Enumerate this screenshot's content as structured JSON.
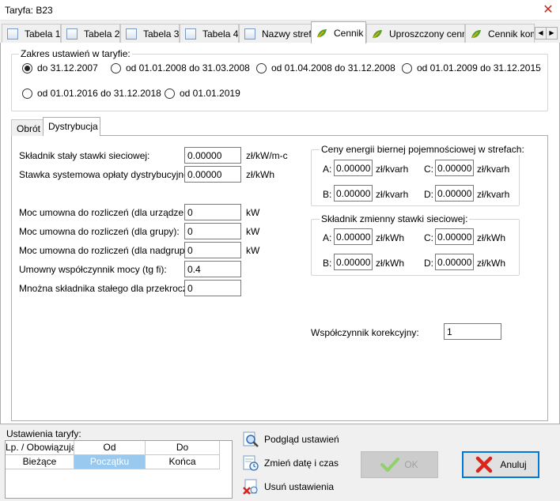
{
  "window": {
    "title": "Taryfa: B23"
  },
  "tabs": [
    {
      "label": "Tabela 1",
      "icon": "document-icon"
    },
    {
      "label": "Tabela 2",
      "icon": "document-icon"
    },
    {
      "label": "Tabela 3",
      "icon": "document-icon"
    },
    {
      "label": "Tabela 4",
      "icon": "document-icon"
    },
    {
      "label": "Nazwy stref",
      "icon": "document-icon"
    },
    {
      "label": "Cennik",
      "icon": "leaf-icon"
    },
    {
      "label": "Uproszczony cennik",
      "icon": "leaf-icon"
    },
    {
      "label": "Cennik komu",
      "icon": "leaf-icon"
    }
  ],
  "range": {
    "title": "Zakres ustawień w taryfie:",
    "options": [
      "do 31.12.2007",
      "od 01.01.2008 do 31.03.2008",
      "od 01.04.2008 do 31.12.2008",
      "od 01.01.2009 do 31.12.2015",
      "od 01.01.2016 do 31.12.2018",
      "od 01.01.2019"
    ],
    "selected": 0
  },
  "inner_tabs": [
    "Obrót",
    "Dystrybucja"
  ],
  "fields": {
    "skladnik_staly": {
      "label": "Składnik stały stawki sieciowej:",
      "value": "0.00000",
      "unit": "zł/kW/m-c"
    },
    "stawka_systemowa": {
      "label": "Stawka systemowa opłaty dystrybucyjnej:",
      "value": "0.00000",
      "unit": "zł/kWh"
    },
    "moc_urzadzenia": {
      "label": "Moc umowna do rozliczeń (dla urządzenia):",
      "value": "0",
      "unit": "kW"
    },
    "moc_grupy": {
      "label": "Moc umowna do rozliczeń (dla grupy):",
      "value": "0",
      "unit": "kW"
    },
    "moc_nadgrupy": {
      "label": "Moc umowna do rozliczeń (dla nadgrupy):",
      "value": "0",
      "unit": "kW"
    },
    "wspolczynnik_mocy": {
      "label": "Umowny współczynnik mocy (tg fi):",
      "value": "0.4"
    },
    "mnozna": {
      "label": "Mnożna składnika stałego dla przekroczeń:",
      "value": "0"
    }
  },
  "energia_biernej": {
    "title": "Ceny energii biernej pojemnościowej w strefach:",
    "cells": [
      {
        "label": "A:",
        "value": "0.00000",
        "unit": "zł/kvarh"
      },
      {
        "label": "C:",
        "value": "0.00000",
        "unit": "zł/kvarh"
      },
      {
        "label": "B:",
        "value": "0.00000",
        "unit": "zł/kvarh"
      },
      {
        "label": "D:",
        "value": "0.00000",
        "unit": "zł/kvarh"
      }
    ]
  },
  "skladnik_zmienny": {
    "title": "Składnik zmienny stawki sieciowej:",
    "cells": [
      {
        "label": "A:",
        "value": "0.00000",
        "unit": "zł/kWh"
      },
      {
        "label": "C:",
        "value": "0.00000",
        "unit": "zł/kWh"
      },
      {
        "label": "B:",
        "value": "0.00000",
        "unit": "zł/kWh"
      },
      {
        "label": "D:",
        "value": "0.00000",
        "unit": "zł/kWh"
      }
    ]
  },
  "korekcyjny": {
    "label": "Współczynnik korekcyjny:",
    "value": "1"
  },
  "settings": {
    "title": "Ustawienia taryfy:",
    "headers": [
      "Lp. / Obowiązują",
      "Od",
      "Do"
    ],
    "row": [
      "Bieżące",
      "Początku",
      "Końca"
    ]
  },
  "actions": {
    "preview": "Podgląd ustawień",
    "change_date": "Zmień datę i czas",
    "delete": "Usuń ustawienia"
  },
  "buttons": {
    "ok": "OK",
    "cancel": "Anuluj"
  },
  "colors": {
    "accent": "#0078d7",
    "selected_cell": "#99c9ef",
    "close": "#c42b1c"
  }
}
